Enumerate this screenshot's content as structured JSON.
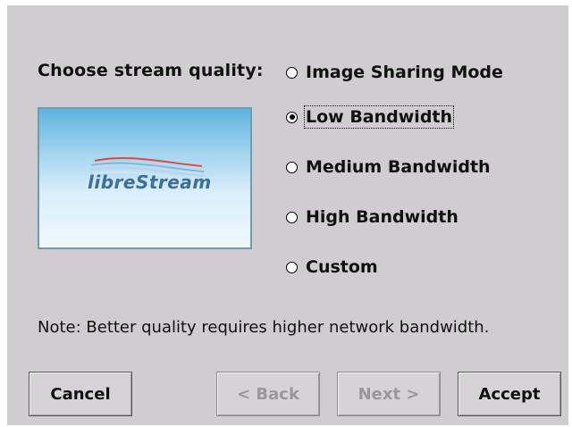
{
  "prompt": "Choose stream quality:",
  "logo": {
    "text": "libreStream"
  },
  "options": [
    {
      "label": "Image Sharing Mode",
      "checked": false
    },
    {
      "label": "Low Bandwidth",
      "checked": true
    },
    {
      "label": "Medium Bandwidth",
      "checked": false
    },
    {
      "label": "High Bandwidth",
      "checked": false
    },
    {
      "label": "Custom",
      "checked": false
    }
  ],
  "note": "Note: Better quality requires higher network bandwidth.",
  "buttons": {
    "cancel": "Cancel",
    "back": "< Back",
    "next": "Next >",
    "accept": "Accept"
  },
  "colors": {
    "dialog_background": "#d0cdd0",
    "disabled_text": "#9a979a",
    "logo_text": "#3f6f95"
  }
}
